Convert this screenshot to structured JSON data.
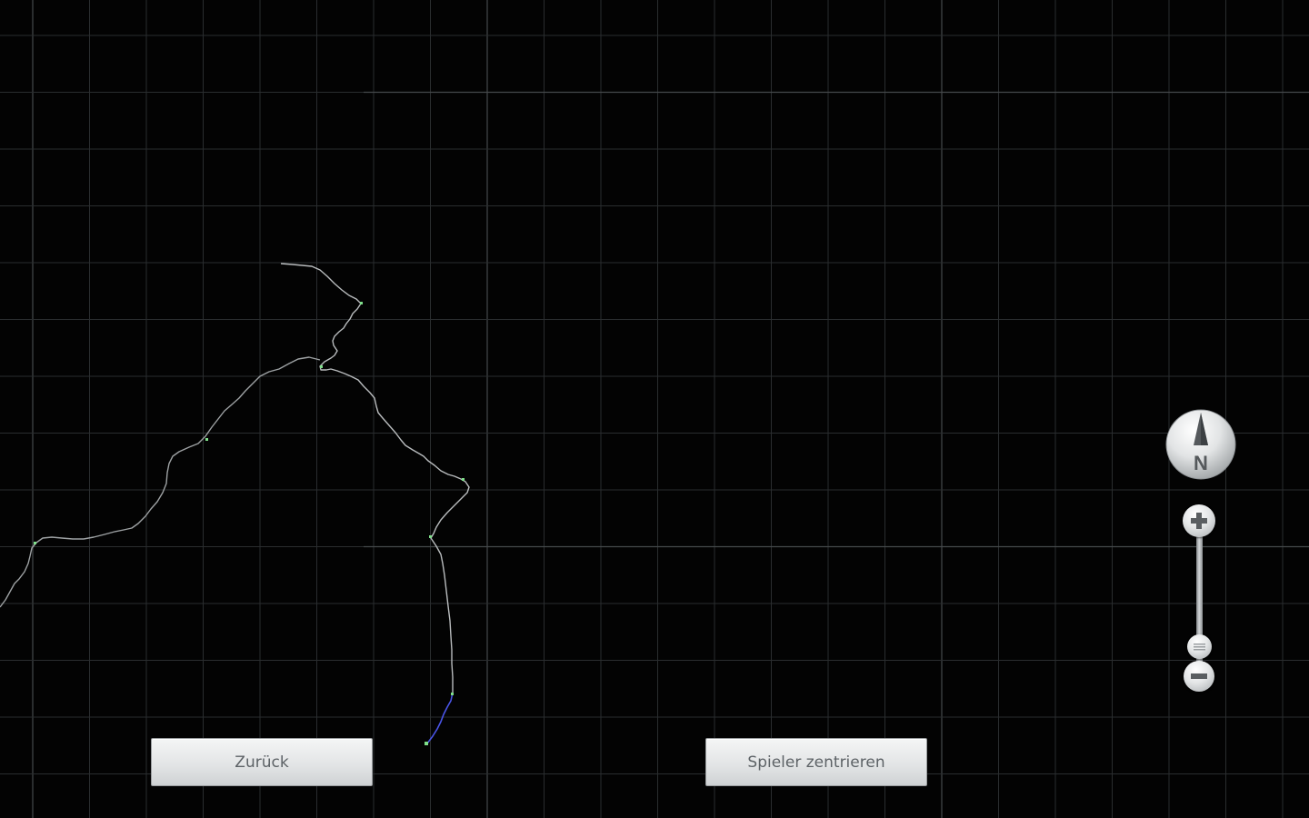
{
  "map": {
    "background": "#030303",
    "grid_color": "#2a2d2f",
    "major_grid_color": "#45494b",
    "track_color": "#b9bcbe",
    "track_recent_color": "#4a55e8"
  },
  "buttons": {
    "back_label": "Zurück",
    "center_player_label": "Spieler zentrieren"
  },
  "compass": {
    "label": "N",
    "icon": "compass-north-icon"
  },
  "zoom": {
    "zoom_in_icon": "plus-icon",
    "zoom_out_icon": "minus-icon",
    "slider_handle_icon": "slider-handle-icon"
  }
}
